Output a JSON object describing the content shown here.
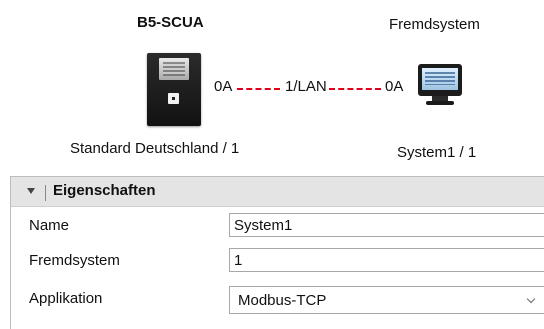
{
  "diagram": {
    "left_device": {
      "title": "B5-SCUA",
      "caption": "Standard Deutschland / 1",
      "port": "0A",
      "icon": "control-panel-icon"
    },
    "right_device": {
      "title": "Fremdsystem",
      "caption": "System1 / 1",
      "port": "0A",
      "icon": "computer-monitor-icon"
    },
    "connection": {
      "label": "1/LAN",
      "color": "#e0001a",
      "style": "dashed"
    }
  },
  "properties": {
    "header": {
      "title": "Eigenschaften",
      "collapse_icon": "collapse-triangle-icon",
      "background": "#e4e4e4"
    },
    "rows": [
      {
        "label": "Name",
        "value": "System1"
      },
      {
        "label": "Fremdsystem",
        "value": "1"
      },
      {
        "label": "Applikation",
        "value": "Modbus-TCP"
      }
    ]
  }
}
